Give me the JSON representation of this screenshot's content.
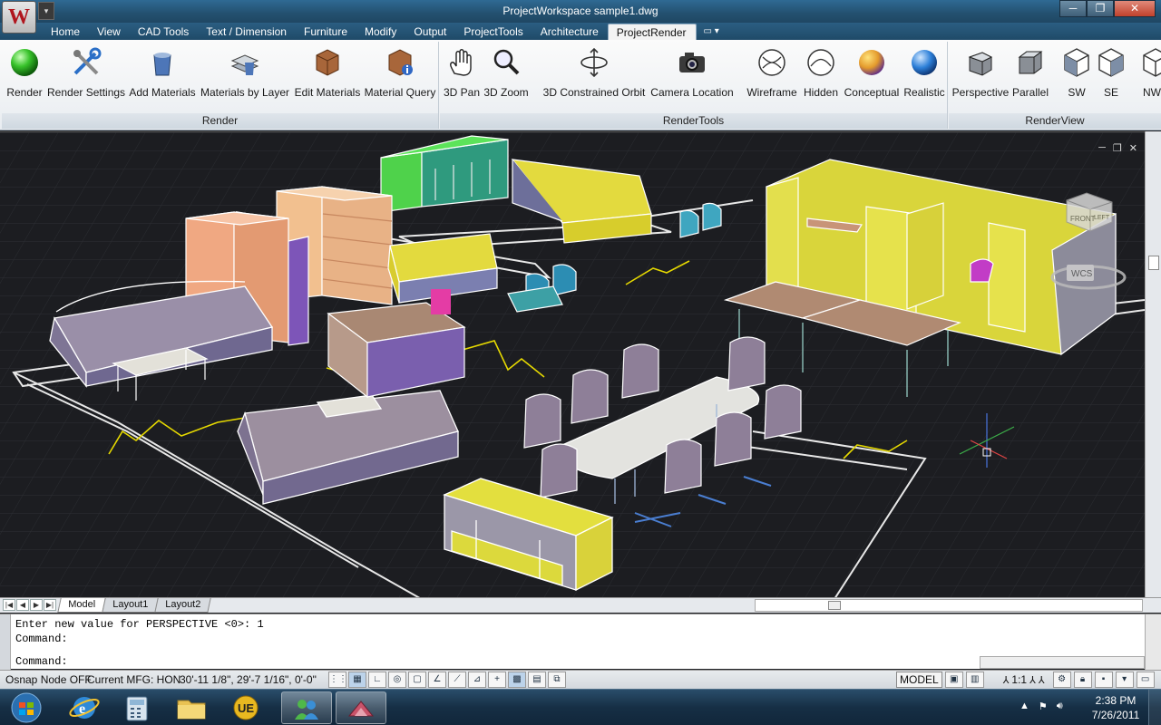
{
  "window": {
    "title": "ProjectWorkspace   sample1.dwg",
    "app_logo": "W",
    "qat_dropdown": "▾",
    "controls": [
      "─",
      "❐",
      "✕"
    ]
  },
  "ribbon_tabs": [
    "Home",
    "View",
    "CAD Tools",
    "Text / Dimension",
    "Furniture",
    "Modify",
    "Output",
    "ProjectTools",
    "Architecture",
    "ProjectRender"
  ],
  "active_tab": "ProjectRender",
  "tab_extra": "▭ ▾",
  "ribbon_groups": {
    "render": {
      "label": "Render",
      "buttons": [
        "Render",
        "Render Settings",
        "Add Materials",
        "Materials by Layer",
        "Edit Materials",
        "Material Query"
      ]
    },
    "rendertools": {
      "label": "RenderTools",
      "buttons": [
        "3D Pan",
        "3D Zoom",
        "3D Constrained Orbit",
        "Camera Location",
        "Wireframe",
        "Hidden",
        "Conceptual",
        "Realistic"
      ]
    },
    "renderview": {
      "label": "RenderView",
      "buttons": [
        "Perspective",
        "Parallel",
        "SW",
        "SE",
        "NW"
      ]
    }
  },
  "viewport": {
    "controls": [
      "─",
      "❐",
      "✕"
    ],
    "viewcube_face": "FRONT",
    "viewcube_side": "LEFT",
    "wcs_label": "WCS"
  },
  "layout_tabs": [
    "Model",
    "Layout1",
    "Layout2"
  ],
  "active_layout": "Model",
  "layout_nav": [
    "|◀",
    "◀",
    "▶",
    "▶|"
  ],
  "command_line": {
    "history": [
      "Enter new value for PERSPECTIVE <0>: 1",
      "Command:"
    ],
    "prompt": "Command:"
  },
  "status_bar": {
    "osnap": "Osnap Node OFF",
    "mfg": "Current MFG: HON",
    "coords": "30'-11 1/8\",  29'-7 1/16\", 0'-0\"",
    "model": "MODEL",
    "scale": "1:1"
  },
  "taskbar": {
    "time": "2:38 PM",
    "date": "7/26/2011"
  },
  "colors": {
    "accent_yellow": "#dede3a",
    "floor": "#1c1d21",
    "title_bar": "#23506f"
  }
}
